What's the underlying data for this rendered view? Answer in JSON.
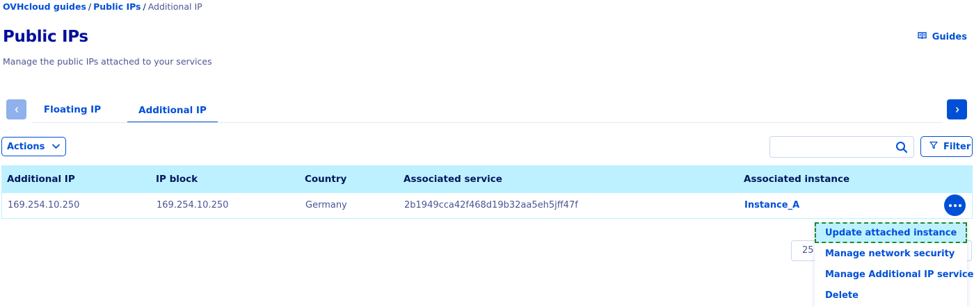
{
  "breadcrumb": {
    "items": [
      "OVHcloud guides",
      "Public IPs"
    ],
    "separator": "/",
    "current": "Additional IP"
  },
  "header": {
    "title": "Public IPs",
    "subtitle": "Manage the public IPs attached to your services",
    "guides_label": "Guides"
  },
  "tabs": [
    {
      "label": "Floating IP",
      "active": false
    },
    {
      "label": "Additional IP",
      "active": true
    }
  ],
  "toolbar": {
    "actions_label": "Actions",
    "search_value": "",
    "filter_label": "Filter"
  },
  "table": {
    "columns": [
      "Additional IP",
      "IP block",
      "Country",
      "Associated service",
      "Associated instance"
    ],
    "rows": [
      [
        "169.254.10.250",
        "169.254.10.250",
        "Germany",
        "2b1949cca42f468d19b32aa5eh5jff47f",
        "Instance_A"
      ]
    ]
  },
  "pagination": {
    "page_size": "25"
  },
  "row_menu": {
    "items": [
      "Update attached instance",
      "Manage network security",
      "Manage Additional IP service",
      "Delete"
    ],
    "highlighted": "Update attached instance"
  },
  "colors": {
    "primary": "#0050d7",
    "title": "#000e9c",
    "header_bg": "#bef1ff",
    "highlight_border": "#1e8a2c"
  },
  "icons": {
    "guides": "book-icon",
    "search": "search-icon",
    "filter": "filter-icon",
    "actions": "chevron-down-icon",
    "tab_prev": "chevron-left-icon",
    "tab_next": "chevron-right-icon",
    "row_actions": "more-icon"
  }
}
